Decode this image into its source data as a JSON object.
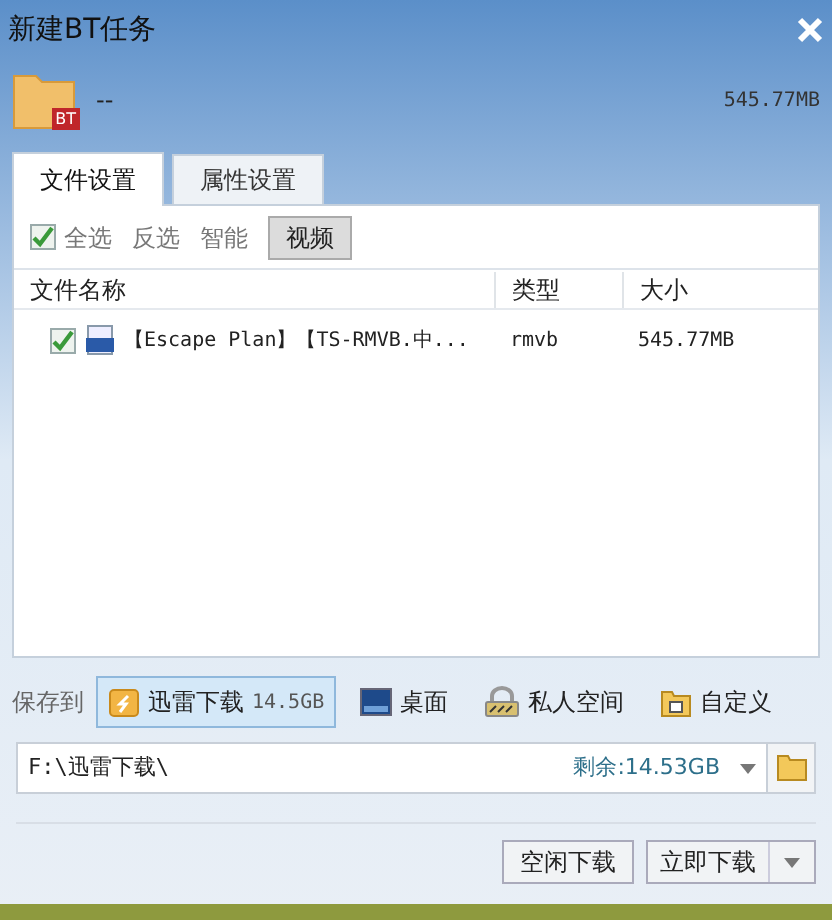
{
  "window": {
    "title": "新建BT任务"
  },
  "task": {
    "badge": "BT",
    "name": "--",
    "size": "545.77MB"
  },
  "tabs": [
    {
      "label": "文件设置",
      "selected": true
    },
    {
      "label": "属性设置",
      "selected": false
    }
  ],
  "filters": [
    {
      "label": "全选",
      "kind": "checkbox",
      "checked": true
    },
    {
      "label": "反选",
      "kind": "link"
    },
    {
      "label": "智能",
      "kind": "link"
    },
    {
      "label": "视频",
      "kind": "toggle",
      "selected": true
    }
  ],
  "table": {
    "columns": [
      "文件名称",
      "类型",
      "大小"
    ],
    "rows": [
      {
        "checked": true,
        "name": "【Escape Plan】【TS-RMVB.中...",
        "type": "rmvb",
        "size": "545.77MB"
      }
    ]
  },
  "save_to": {
    "label": "保存到",
    "options": [
      {
        "kind": "thunder",
        "label": "迅雷下载",
        "free": "14.5GB",
        "selected": true
      },
      {
        "kind": "desktop",
        "label": "桌面",
        "selected": false
      },
      {
        "kind": "private",
        "label": "私人空间",
        "selected": false
      },
      {
        "kind": "custom",
        "label": "自定义",
        "selected": false
      }
    ]
  },
  "path": {
    "value": "F:\\迅雷下载\\",
    "remaining": "剩余:14.53GB"
  },
  "buttons": [
    {
      "label": "空闲下载",
      "kind": "plain"
    },
    {
      "label": "立即下载",
      "kind": "split"
    }
  ]
}
